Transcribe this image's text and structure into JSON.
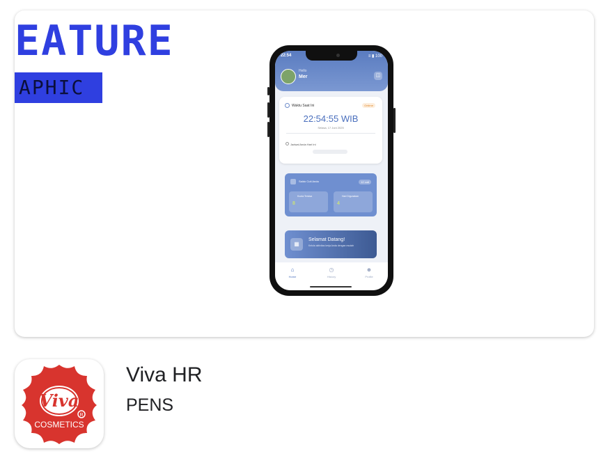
{
  "promo": {
    "headline_fragment": "EATURE",
    "subline_fragment": "APHIC"
  },
  "phone_screen": {
    "status_time": "22:54",
    "status_right": "≡ ▮ 100",
    "greeting": "Hello",
    "user_name": "Mer",
    "waktu_card": {
      "label": "Waktu Saat Ini",
      "badge": "Ontime",
      "time": "22:54:55 WIB",
      "date": "Selasa, 17 Juni 2025",
      "schedule_label": "Jadwal Anda Hari Ini"
    },
    "cuti_card": {
      "label": "Saldo Cuti Anda",
      "badge": "12 cuti",
      "box1_label": "Kuota Tersisa",
      "box1_value": "8",
      "box2_label": "Hari Digunakan",
      "box2_value": "4"
    },
    "welcome_card": {
      "title": "Selamat Datang!",
      "subtitle": "Kelola aktivitas kerja Anda dengan mudah"
    },
    "nav": {
      "home": "Home",
      "history": "History",
      "profile": "Profile"
    }
  },
  "app": {
    "name": "Viva HR",
    "developer": "PENS",
    "icon_brand": "Viva",
    "icon_tagline": "COSMETICS",
    "icon_mark": "R"
  },
  "colors": {
    "promo_blue": "#2f3fe0",
    "icon_red": "#d8342e",
    "phone_accent": "#5a7cc0"
  }
}
